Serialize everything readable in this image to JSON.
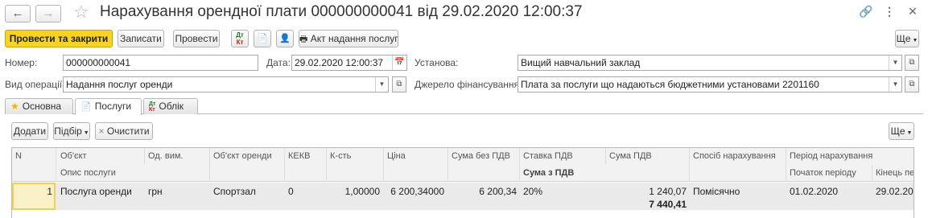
{
  "window": {
    "title": "Нарахування орендної плати 000000000041 від 29.02.2020 12:00:37"
  },
  "toolbar": {
    "post_and_close": "Провести та закрити",
    "save": "Записати",
    "post": "Провести",
    "dt": "Дт",
    "kt": "Кт",
    "act_label": "Акт надання послуг",
    "more": "Ще"
  },
  "form": {
    "number_label": "Номер:",
    "number_value": "000000000041",
    "date_label": "Дата:",
    "date_value": "29.02.2020 12:00:37",
    "institution_label": "Установа:",
    "institution_value": "Вищий навчальний заклад",
    "operation_label": "Вид операції:",
    "operation_value": "Надання послуг оренди",
    "funding_label": "Джерело фінансування:",
    "funding_value": "Плата за послуги що надаються бюджетними установами 2201160"
  },
  "tabs": [
    {
      "label": "Основна"
    },
    {
      "label": "Послуги"
    },
    {
      "label": "Облік"
    }
  ],
  "services_toolbar": {
    "add": "Додати",
    "pick": "Підбір",
    "clear": "Очистити",
    "more": "Ще"
  },
  "grid": {
    "headers_row1": [
      "N",
      "Об'єкт",
      "Од. вим.",
      "Об'єкт оренди",
      "КЕКВ",
      "К-сть",
      "Ціна",
      "Сума без ПДВ",
      "Ставка ПДВ",
      "Сума ПДВ",
      "Спосіб нарахування",
      "Період нарахування"
    ],
    "headers_row2": {
      "service_desc": "Опис послуги",
      "sum_with_vat": "Сума з ПДВ",
      "period_start": "Початок періоду",
      "period_end": "Кінець пе"
    },
    "rows": [
      {
        "n": "1",
        "object": "Послуга оренди",
        "unit": "грн",
        "rent_object": "Спортзал",
        "kekv": "0",
        "qty": "1,00000",
        "price": "6 200,34000",
        "sum_no_vat": "6 200,34",
        "vat_rate": "20%",
        "vat_sum": "1 240,07",
        "total": "7 440,41",
        "method": "Помісячно",
        "start": "01.02.2020",
        "end": "29.02.202"
      }
    ]
  }
}
